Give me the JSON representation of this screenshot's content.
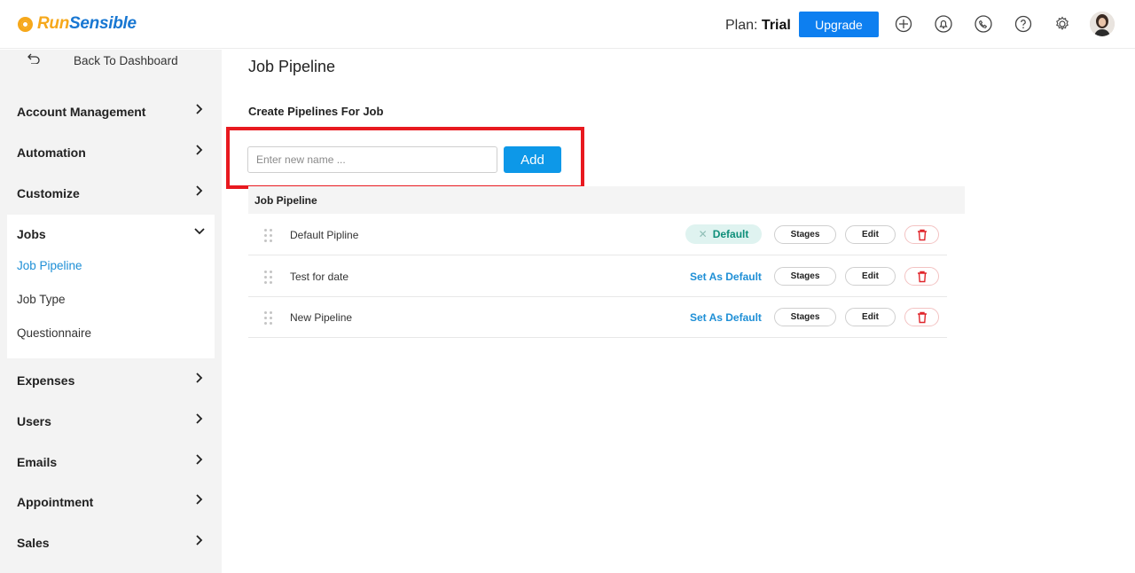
{
  "header": {
    "logo_run": "Run",
    "logo_sensible": "Sensible",
    "plan_label": "Plan:",
    "plan_value": "Trial",
    "upgrade_label": "Upgrade",
    "icons": [
      "add-circle-icon",
      "bell-icon",
      "phone-icon",
      "help-icon",
      "gear-icon",
      "avatar"
    ]
  },
  "sidebar": {
    "back_label": "Back To Dashboard",
    "items": [
      {
        "label": "Account Management"
      },
      {
        "label": "Automation"
      },
      {
        "label": "Customize"
      },
      {
        "label": "Jobs",
        "expanded": true
      },
      {
        "label": "Expenses"
      },
      {
        "label": "Users"
      },
      {
        "label": "Emails"
      },
      {
        "label": "Appointment"
      },
      {
        "label": "Sales"
      }
    ],
    "jobs_sub": [
      {
        "label": "Job Pipeline",
        "active": true
      },
      {
        "label": "Job Type"
      },
      {
        "label": "Questionnaire"
      }
    ]
  },
  "main": {
    "title": "Job Pipeline",
    "create_label": "Create Pipelines For Job",
    "input_placeholder": "Enter new name ...",
    "add_label": "Add",
    "table_header": "Job Pipeline",
    "rows": [
      {
        "name": "Default Pipline",
        "is_default": true,
        "default_label": "Default"
      },
      {
        "name": "Test for date",
        "is_default": false,
        "set_default_label": "Set As Default"
      },
      {
        "name": "New Pipeline",
        "is_default": false,
        "set_default_label": "Set As Default"
      }
    ],
    "stages_label": "Stages",
    "edit_label": "Edit"
  },
  "colors": {
    "accent": "#0d7ff0",
    "link": "#1e8fd6",
    "highlight": "#e8191f",
    "default_pill_bg": "#dff3f0",
    "default_pill_text": "#0f8f7a",
    "delete": "#e0252b"
  }
}
